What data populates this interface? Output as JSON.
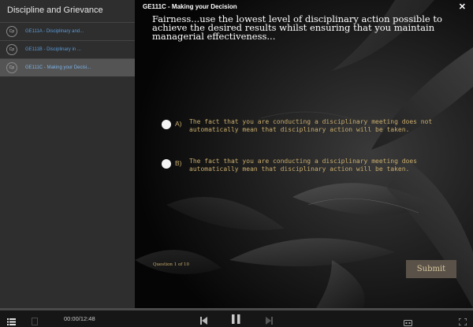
{
  "sidebar": {
    "title": "Discipline and Grievance",
    "items": [
      {
        "icon_text": "Cp",
        "label": "GE111A - Disciplinary and..."
      },
      {
        "icon_text": "Cp",
        "label": "GE111B - Disciplinary in ..."
      },
      {
        "icon_text": "Cp",
        "label": "GE111C - Making your Decisi..."
      }
    ]
  },
  "header": {
    "title": "GE111C - Making your Decision",
    "close_label": "✕"
  },
  "quiz": {
    "question": "Fairness...use the lowest level of disciplinary action possible to achieve the desired results whilst ensuring that you maintain managerial effectiveness...",
    "options": [
      {
        "letter": "A)",
        "text": "The fact that you are conducting a disciplinary meeting does not automatically mean that disciplinary action will be taken."
      },
      {
        "letter": "B)",
        "text": "The fact that you are conducting a disciplinary meeting does automatically mean that disciplinary action will be taken."
      }
    ],
    "progress": "Question 1 of 10",
    "submit_label": "Submit"
  },
  "player": {
    "time": "00:00/12:48",
    "progress_fraction": 0.0,
    "icons": [
      "list-icon",
      "transcript-icon",
      "rewind-icon",
      "pause-icon",
      "forward-icon",
      "captions-icon",
      "fullscreen-icon"
    ]
  },
  "colors": {
    "accent_gold": "#c9ad6d",
    "link_blue": "#5a9bd8",
    "sidebar_bg": "#2e2e2e"
  }
}
